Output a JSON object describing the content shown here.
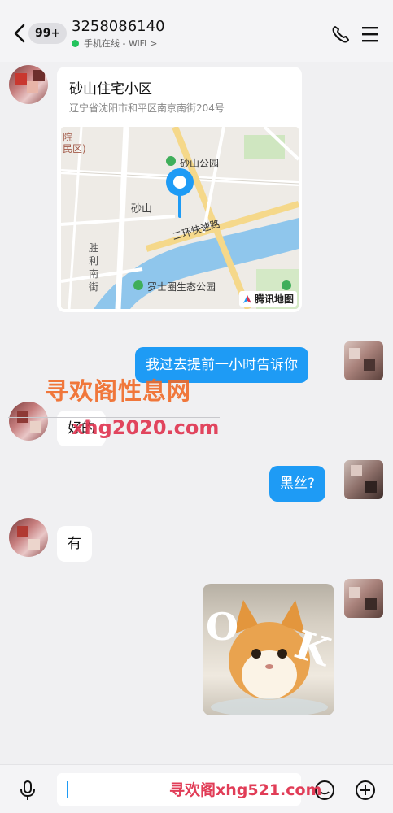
{
  "header": {
    "back_icon": "back-chevron-icon",
    "unread_badge": "99+",
    "peer_name": "3258086140",
    "status": "手机在线 - WiFi",
    "status_chevron": ">",
    "call_icon": "phone-icon",
    "menu_icon": "hamburger-menu-icon"
  },
  "messages": {
    "location": {
      "title": "砂山住宅小区",
      "address": "辽宁省沈阳市和平区南京南街204号",
      "map_labels": {
        "park1": "砂山公园",
        "area": "砂山",
        "road": "二环快速路",
        "park2": "罗士圈生态公园",
        "side1": "胜",
        "side2": "利",
        "side3": "南",
        "side4": "街",
        "corner_top1": "院",
        "corner_top2": "民区)",
        "map_brand": "腾讯地图"
      }
    },
    "out1": "我过去提前一小时告诉你",
    "in1": "好的",
    "out2": "黑丝?",
    "in2": "有",
    "sticker_letters": [
      "O",
      "K"
    ]
  },
  "watermarks": {
    "top_cn": "寻欢阁性息网",
    "top_url": "xhg2020.com",
    "bottom": "寻欢阁xhg521.com"
  },
  "input_bar": {
    "voice_icon": "microphone-icon",
    "emoji_icon": "emoji-icon",
    "plus_icon": "plus-circle-icon"
  },
  "colors": {
    "accent_blue": "#1e9bf5",
    "online_green": "#23c35d",
    "watermark_orange": "#f06a28",
    "watermark_red": "#e0334f"
  }
}
